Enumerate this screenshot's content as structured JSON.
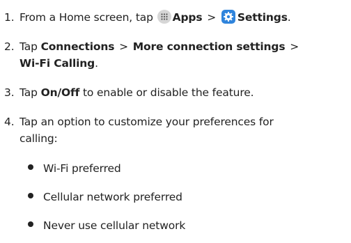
{
  "steps": [
    {
      "number": "1.",
      "prefix": "From a Home screen, tap",
      "apps_label": "Apps",
      "separator": ">",
      "settings_label": "Settings",
      "end": "."
    },
    {
      "number": "2.",
      "tap": "Tap",
      "connections_label": "Connections",
      "separator": ">",
      "more_label": "More connection settings",
      "separator2": ">",
      "wifi_calling_label": "Wi-Fi Calling",
      "end": "."
    },
    {
      "number": "3.",
      "tap": "Tap",
      "onoff_label": "On/Off",
      "suffix": "to enable or disable the feature."
    },
    {
      "number": "4.",
      "line1": "Tap an option to customize your preferences for",
      "line2": "calling:"
    }
  ],
  "options": [
    "Wi-Fi preferred",
    "Cellular network preferred",
    "Never use cellular network"
  ],
  "icons": {
    "apps": "apps-grid-icon",
    "settings": "settings-gear-icon"
  },
  "colors": {
    "text": "#222222",
    "settings_icon_bg": "#2f84dc",
    "apps_icon_bg": "#d6d6d6"
  }
}
